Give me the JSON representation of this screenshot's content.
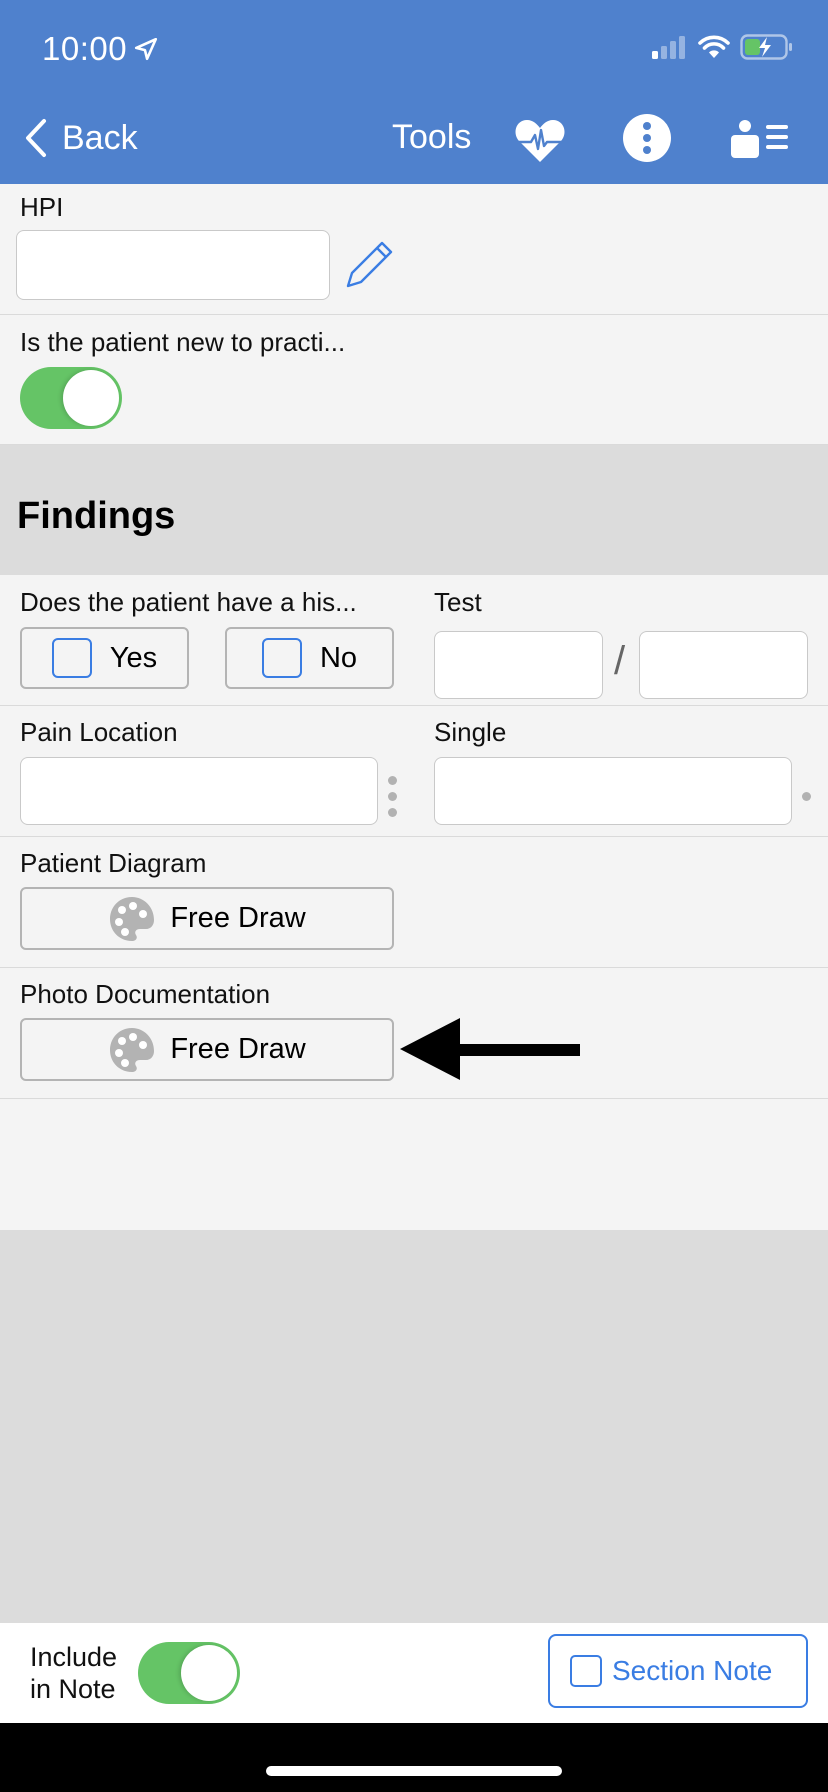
{
  "status_bar": {
    "time": "10:00",
    "location_icon": "location-arrow-icon",
    "signal_icon": "cellular-signal-icon",
    "wifi_icon": "wifi-icon",
    "battery_icon": "battery-charging-icon"
  },
  "nav": {
    "back_label": "Back",
    "tools_label": "Tools",
    "icons": [
      "heart-pulse-icon",
      "more-vertical-icon",
      "patient-list-icon"
    ]
  },
  "form": {
    "hpi": {
      "label": "HPI",
      "value": "",
      "edit_icon": "pencil-icon"
    },
    "new_patient": {
      "label": "Is the patient new to practi...",
      "toggle_on": true
    },
    "findings": {
      "title": "Findings",
      "history_question": {
        "label": "Does the patient have a his...",
        "options": [
          {
            "label": "Yes",
            "checked": false
          },
          {
            "label": "No",
            "checked": false
          }
        ]
      },
      "test": {
        "label": "Test",
        "value_1": "",
        "value_2": "",
        "separator": "/"
      },
      "pain_location": {
        "label": "Pain Location",
        "value": ""
      },
      "single": {
        "label": "Single",
        "value": ""
      },
      "patient_diagram": {
        "label": "Patient Diagram",
        "button_label": "Free Draw",
        "button_icon": "palette-icon"
      },
      "photo_documentation": {
        "label": "Photo Documentation",
        "button_label": "Free Draw",
        "button_icon": "palette-icon"
      }
    }
  },
  "annotation": {
    "arrow_icon": "arrow-left-icon"
  },
  "bottom_bar": {
    "include_label_line1": "Include",
    "include_label_line2": "in Note",
    "include_toggle_on": true,
    "section_note_label": "Section Note",
    "section_note_checked": false
  },
  "colors": {
    "header_bg": "#4f81cd",
    "accent_blue": "#3a7de3",
    "toggle_green": "#65c466"
  }
}
